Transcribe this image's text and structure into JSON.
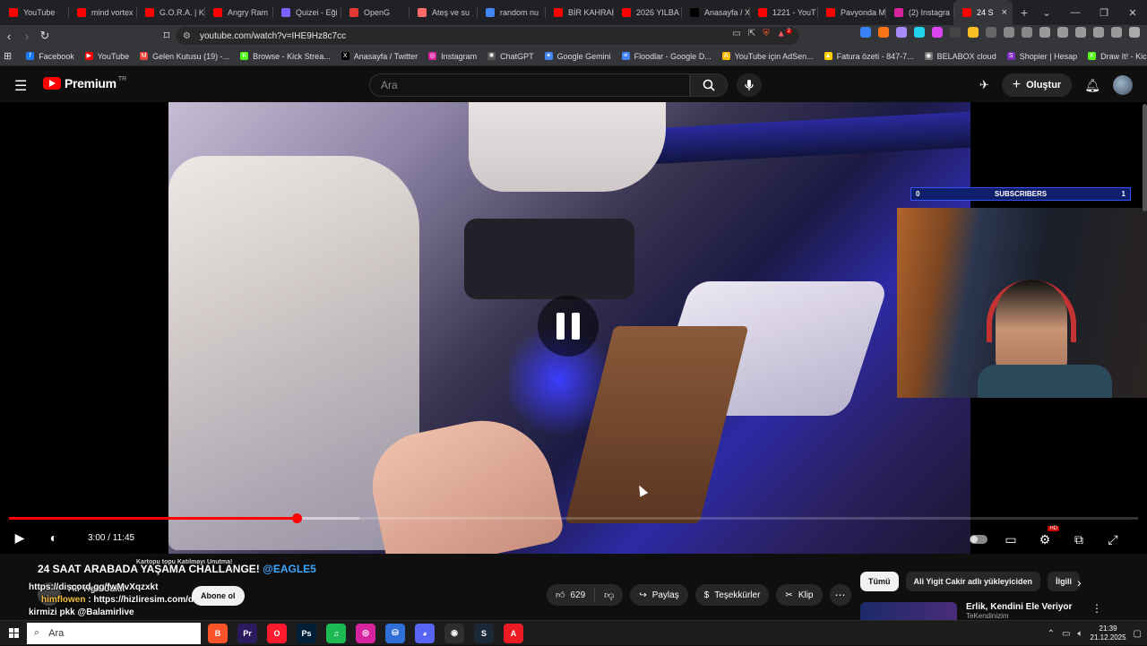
{
  "browser": {
    "tabs": [
      {
        "title": "YouTube",
        "color": "#ff0000",
        "active": false
      },
      {
        "title": "mind vortex",
        "color": "#ff0000",
        "active": false
      },
      {
        "title": "G.O.R.A. | Ka",
        "color": "#ff0000",
        "active": false
      },
      {
        "title": "Angry Ram",
        "color": "#ff0000",
        "active": false
      },
      {
        "title": "Quizei - Eği",
        "color": "#7b61ff",
        "active": false
      },
      {
        "title": "OpenG",
        "color": "#e53935",
        "active": false
      },
      {
        "title": "Ateş ve su",
        "color": "#ff6b6b",
        "active": false
      },
      {
        "title": "random nu",
        "color": "#4285f4",
        "active": false
      },
      {
        "title": "BİR KAHRAM",
        "color": "#ff0000",
        "active": false
      },
      {
        "title": "2026 YILBA",
        "color": "#ff0000",
        "active": false
      },
      {
        "title": "Anasayfa / X",
        "color": "#000000",
        "active": false
      },
      {
        "title": "1221 - YouT",
        "color": "#ff0000",
        "active": false
      },
      {
        "title": "Pavyonda M",
        "color": "#ff0000",
        "active": false
      },
      {
        "title": "(2) Instagra",
        "color": "#d6249f",
        "active": false
      },
      {
        "title": "24 S",
        "color": "#ff0000",
        "active": true
      }
    ],
    "new_tab": "+",
    "window_controls": [
      "⌄",
      "—",
      "❐",
      "✕"
    ],
    "url": "youtube.com/watch?v=IHE9Hz8c7cc",
    "extension_badge": "2",
    "bookmarks": [
      {
        "label": "Facebook",
        "color": "#1877f2",
        "glyph": "f"
      },
      {
        "label": "YouTube",
        "color": "#ff0000",
        "glyph": "▶"
      },
      {
        "label": "Gelen Kutusu (19) -...",
        "color": "#ea4335",
        "glyph": "M"
      },
      {
        "label": "Browse - Kick Strea...",
        "color": "#53fc18",
        "glyph": "K"
      },
      {
        "label": "Anasayfa / Twitter",
        "color": "#000000",
        "glyph": "X"
      },
      {
        "label": "Instagram",
        "color": "#d6249f",
        "glyph": "◎"
      },
      {
        "label": "ChatGPT",
        "color": "#555555",
        "glyph": "✺"
      },
      {
        "label": "Google Gemini",
        "color": "#4285f4",
        "glyph": "✦"
      },
      {
        "label": "Floodlar - Google D...",
        "color": "#4285f4",
        "glyph": "≡"
      },
      {
        "label": "YouTube için AdSen...",
        "color": "#fbbc04",
        "glyph": "A"
      },
      {
        "label": "Fatura özeti - 847-7...",
        "color": "#ffd000",
        "glyph": "▲"
      },
      {
        "label": "BELABOX cloud",
        "color": "#777777",
        "glyph": "◉"
      },
      {
        "label": "Shopier | Hesap",
        "color": "#7b2cbf",
        "glyph": "S"
      },
      {
        "label": "Draw It! - Kick Yayın...",
        "color": "#53fc18",
        "glyph": "K"
      }
    ]
  },
  "youtube": {
    "logo_text": "Premium",
    "logo_region": "TR",
    "search_placeholder": "Ara",
    "create_label": "Oluştur",
    "player": {
      "current_time": "3:00",
      "duration": "11:45",
      "time_display": "3:00 / 11:45",
      "played_fraction": 0.255,
      "buffered_fraction": 0.31,
      "state": "paused",
      "hd_badge": "HD"
    },
    "stream_overlay": {
      "subscribers_label": "SUBSCRIBERS",
      "subscribers_current": "0",
      "subscribers_goal": "1"
    },
    "video": {
      "title_main": "24 SAAT ARABADA YAŞAMA CHALLANGE!",
      "title_tag": "@EAGLE5",
      "channel_name": "Ali Yigit Cakir",
      "subscribe_label": "Abone ol",
      "like_count": "629",
      "share_label": "Paylaş",
      "thanks_label": "Teşekkürler",
      "clip_label": "Klip"
    },
    "chat_overlay": {
      "line1": "https://discord.gg/fwMvXqzxkt",
      "line2_user": "himflowen",
      "line2_text": ": https://hizliresim.com/deskdo...",
      "line3": "kirmizi pkk @Balamirlive",
      "line0": "Kartopu topu Katılmayı Unutma!"
    },
    "chips": [
      {
        "label": "Tümü",
        "active": true
      },
      {
        "label": "Ali Yigit Cakir adlı yükleyiciden",
        "active": false
      },
      {
        "label": "İlgili",
        "active": false
      }
    ],
    "recommendation": {
      "title": "Erlik, Kendini Ele Veriyor",
      "channel": "TeKendinizim"
    }
  },
  "taskbar": {
    "search_placeholder": "Ara",
    "apps": [
      {
        "name": "brave",
        "color": "#fb542b",
        "glyph": "B"
      },
      {
        "name": "premiere",
        "color": "#2a1a5e",
        "glyph": "Pr"
      },
      {
        "name": "opera",
        "color": "#ff1b2d",
        "glyph": "O"
      },
      {
        "name": "photoshop",
        "color": "#001e36",
        "glyph": "Ps"
      },
      {
        "name": "spotify",
        "color": "#1db954",
        "glyph": "♫"
      },
      {
        "name": "instagram",
        "color": "#d6249f",
        "glyph": "◎"
      },
      {
        "name": "network",
        "color": "#2f6fd6",
        "glyph": "⛁"
      },
      {
        "name": "discord",
        "color": "#5865f2",
        "glyph": "◕"
      },
      {
        "name": "obs",
        "color": "#302e31",
        "glyph": "◉"
      },
      {
        "name": "steam",
        "color": "#1b2838",
        "glyph": "S"
      },
      {
        "name": "adobe",
        "color": "#ed1c24",
        "glyph": "A"
      }
    ],
    "time": "21:39",
    "date": "21.12.2025"
  }
}
